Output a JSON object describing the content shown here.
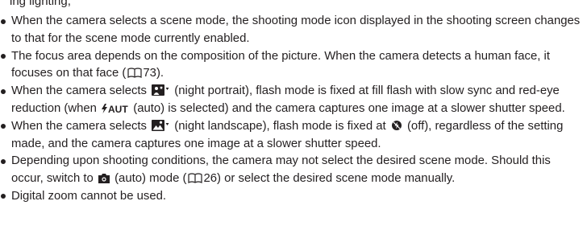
{
  "cut_line_text": "ing lighting,",
  "bullets": [
    {
      "parts": [
        "When the camera selects a scene mode, the shooting mode icon displayed in the shooting screen changes to that for the scene mode currently enabled."
      ]
    },
    {
      "parts": [
        "The focus area depends on the composition of the picture. When the camera detects a human face, it focuses on that face (",
        "73)."
      ],
      "ref_page": "73"
    },
    {
      "parts": [
        "When the camera selects ",
        " (night portrait), flash mode is fixed at fill flash with slow sync and red-eye reduction (when ",
        " (auto) is selected) and the camera captures one image at a slower shutter speed."
      ],
      "flash_label": "AUTO"
    },
    {
      "parts": [
        "When the camera selects ",
        " (night landscape), flash mode is fixed at ",
        " (off), regardless of the setting made, and the camera captures one image at a slower shutter speed."
      ]
    },
    {
      "parts": [
        "Depending upon shooting conditions, the camera may not select the desired scene mode. Should this occur, switch to ",
        " (auto) mode (",
        "26) or select the desired scene mode manually."
      ],
      "ref_page": "26"
    },
    {
      "parts": [
        "Digital zoom cannot be used."
      ]
    }
  ],
  "icons": {
    "manual_ref": "book-reference-icon",
    "night_portrait": "night-portrait-scene-icon",
    "night_landscape": "night-landscape-scene-icon",
    "flash_auto": "flash-auto-icon",
    "flash_off": "flash-off-icon",
    "auto_mode": "auto-camera-icon"
  },
  "colors": {
    "text": "#231f20",
    "background": "#ffffff"
  }
}
